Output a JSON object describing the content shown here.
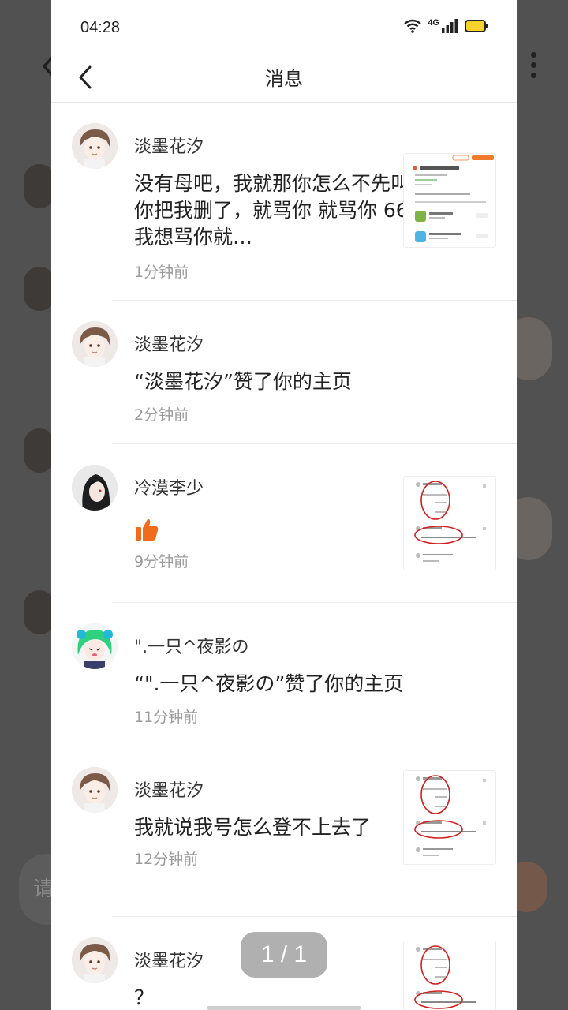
{
  "status_bar": {
    "time": "04:28",
    "network": "4G"
  },
  "header": {
    "title": "消息"
  },
  "messages": [
    {
      "username": "淡墨花汐",
      "content": "没有母吧，我就那你怎么不先叫你把我删了，就骂你 就骂你 66我想骂你就…",
      "time": "1分钟前",
      "has_thumb": true
    },
    {
      "username": "淡墨花汐",
      "content": "“淡墨花汐”赞了你的主页",
      "time": "2分钟前",
      "has_thumb": false
    },
    {
      "username": "冷漠李少",
      "content": "",
      "reaction": "thumbs-up",
      "time": "9分钟前",
      "has_thumb": true
    },
    {
      "username": "\".一只^夜影の",
      "content": "“\".一只^夜影の”赞了你的主页",
      "time": "11分钟前",
      "has_thumb": false
    },
    {
      "username": "淡墨花汐",
      "content": "我就说我号怎么登不上去了",
      "time": "12分钟前",
      "has_thumb": true
    },
    {
      "username": "淡墨花汐",
      "content": "？",
      "time": "",
      "has_thumb": true
    }
  ],
  "background": {
    "input_placeholder": "请"
  },
  "pager": {
    "label": "1 / 1"
  },
  "colors": {
    "accent": "#f26a1b",
    "annotation_red": "#d21f1f"
  }
}
